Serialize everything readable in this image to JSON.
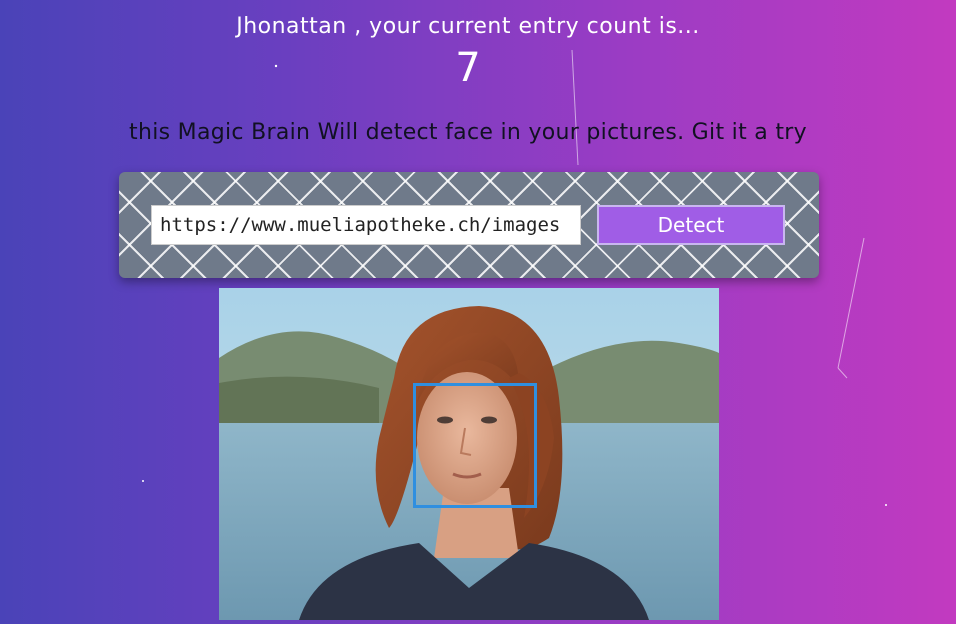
{
  "user": {
    "entry_message": "Jhonattan , your current entry count is...",
    "entry_count": "7"
  },
  "tagline": "this Magic Brain Will detect face in your pictures. Git it a try",
  "form": {
    "url_value": "https://www.mueliapotheke.ch/images",
    "detect_label": "Detect"
  },
  "image": {
    "description_icon": "portrait-photo",
    "face_box_color": "#2f8fe0"
  },
  "colors": {
    "bg_left": "#4a43b8",
    "bg_right": "#c23ac0",
    "button": "#a05de6"
  }
}
